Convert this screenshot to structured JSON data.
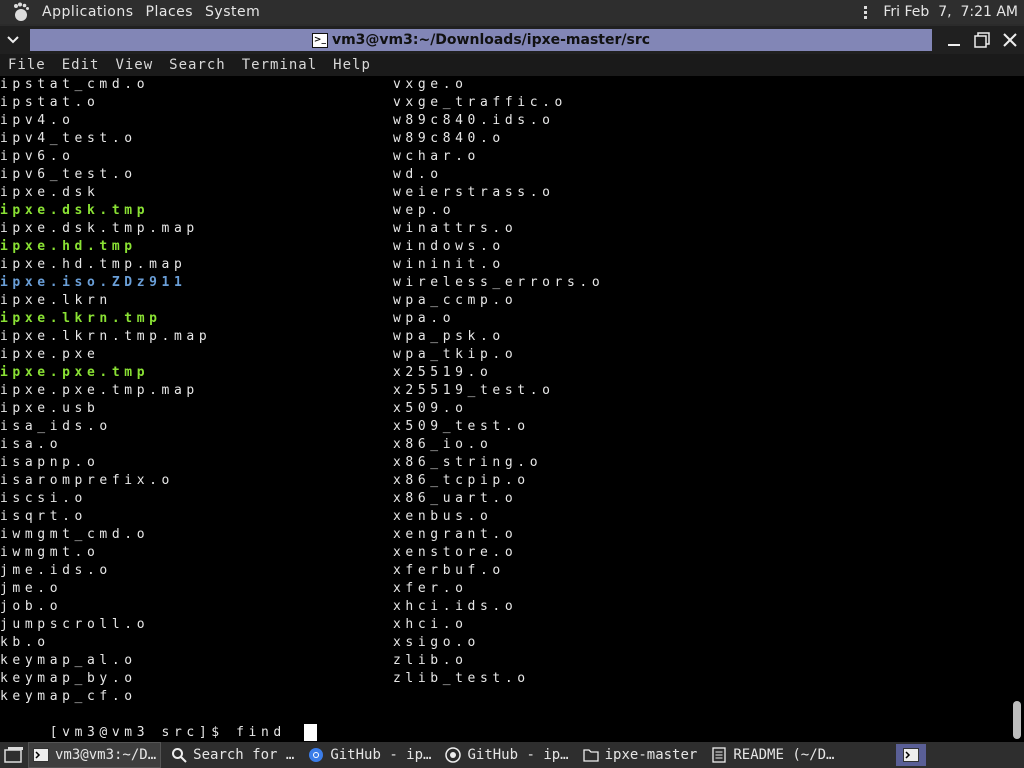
{
  "top_panel": {
    "menus": [
      "Applications",
      "Places",
      "System"
    ],
    "datetime": "Fri Feb  7,  7:21 AM"
  },
  "window": {
    "title": "vm3@vm3:~/Downloads/ipxe-master/src"
  },
  "terminal_menu": [
    "File",
    "Edit",
    "View",
    "Search",
    "Terminal",
    "Help"
  ],
  "terminal": {
    "left_column": [
      {
        "text": "ipstat_cmd.o",
        "style": "normal"
      },
      {
        "text": "ipstat.o",
        "style": "normal"
      },
      {
        "text": "ipv4.o",
        "style": "normal"
      },
      {
        "text": "ipv4_test.o",
        "style": "normal"
      },
      {
        "text": "ipv6.o",
        "style": "normal"
      },
      {
        "text": "ipv6_test.o",
        "style": "normal"
      },
      {
        "text": "ipxe.dsk",
        "style": "normal"
      },
      {
        "text": "ipxe.dsk.tmp",
        "style": "green"
      },
      {
        "text": "ipxe.dsk.tmp.map",
        "style": "normal"
      },
      {
        "text": "ipxe.hd.tmp",
        "style": "green"
      },
      {
        "text": "ipxe.hd.tmp.map",
        "style": "normal"
      },
      {
        "text": "ipxe.iso.ZDz911",
        "style": "blue"
      },
      {
        "text": "ipxe.lkrn",
        "style": "normal"
      },
      {
        "text": "ipxe.lkrn.tmp",
        "style": "green"
      },
      {
        "text": "ipxe.lkrn.tmp.map",
        "style": "normal"
      },
      {
        "text": "ipxe.pxe",
        "style": "normal"
      },
      {
        "text": "ipxe.pxe.tmp",
        "style": "green"
      },
      {
        "text": "ipxe.pxe.tmp.map",
        "style": "normal"
      },
      {
        "text": "ipxe.usb",
        "style": "normal"
      },
      {
        "text": "isa_ids.o",
        "style": "normal"
      },
      {
        "text": "isa.o",
        "style": "normal"
      },
      {
        "text": "isapnp.o",
        "style": "normal"
      },
      {
        "text": "isaromprefix.o",
        "style": "normal"
      },
      {
        "text": "iscsi.o",
        "style": "normal"
      },
      {
        "text": "isqrt.o",
        "style": "normal"
      },
      {
        "text": "iwmgmt_cmd.o",
        "style": "normal"
      },
      {
        "text": "iwmgmt.o",
        "style": "normal"
      },
      {
        "text": "jme.ids.o",
        "style": "normal"
      },
      {
        "text": "jme.o",
        "style": "normal"
      },
      {
        "text": "job.o",
        "style": "normal"
      },
      {
        "text": "jumpscroll.o",
        "style": "normal"
      },
      {
        "text": "kb.o",
        "style": "normal"
      },
      {
        "text": "keymap_al.o",
        "style": "normal"
      },
      {
        "text": "keymap_by.o",
        "style": "normal"
      },
      {
        "text": "keymap_cf.o",
        "style": "normal"
      }
    ],
    "right_column": [
      {
        "text": "vxge.o",
        "style": "normal"
      },
      {
        "text": "vxge_traffic.o",
        "style": "normal"
      },
      {
        "text": "w89c840.ids.o",
        "style": "normal"
      },
      {
        "text": "w89c840.o",
        "style": "normal"
      },
      {
        "text": "wchar.o",
        "style": "normal"
      },
      {
        "text": "wd.o",
        "style": "normal"
      },
      {
        "text": "weierstrass.o",
        "style": "normal"
      },
      {
        "text": "wep.o",
        "style": "normal"
      },
      {
        "text": "winattrs.o",
        "style": "normal"
      },
      {
        "text": "windows.o",
        "style": "normal"
      },
      {
        "text": "wininit.o",
        "style": "normal"
      },
      {
        "text": "wireless_errors.o",
        "style": "normal"
      },
      {
        "text": "wpa_ccmp.o",
        "style": "normal"
      },
      {
        "text": "wpa.o",
        "style": "normal"
      },
      {
        "text": "wpa_psk.o",
        "style": "normal"
      },
      {
        "text": "wpa_tkip.o",
        "style": "normal"
      },
      {
        "text": "x25519.o",
        "style": "normal"
      },
      {
        "text": "x25519_test.o",
        "style": "normal"
      },
      {
        "text": "x509.o",
        "style": "normal"
      },
      {
        "text": "x509_test.o",
        "style": "normal"
      },
      {
        "text": "x86_io.o",
        "style": "normal"
      },
      {
        "text": "x86_string.o",
        "style": "normal"
      },
      {
        "text": "x86_tcpip.o",
        "style": "normal"
      },
      {
        "text": "x86_uart.o",
        "style": "normal"
      },
      {
        "text": "xenbus.o",
        "style": "normal"
      },
      {
        "text": "xengrant.o",
        "style": "normal"
      },
      {
        "text": "xenstore.o",
        "style": "normal"
      },
      {
        "text": "xferbuf.o",
        "style": "normal"
      },
      {
        "text": "xfer.o",
        "style": "normal"
      },
      {
        "text": "xhci.ids.o",
        "style": "normal"
      },
      {
        "text": "xhci.o",
        "style": "normal"
      },
      {
        "text": "xsigo.o",
        "style": "normal"
      },
      {
        "text": "zlib.o",
        "style": "normal"
      },
      {
        "text": "zlib_test.o",
        "style": "normal"
      }
    ],
    "prompt": "[vm3@vm3 src]$ find "
  },
  "colors": {
    "executable_green": "#8ae234",
    "directory_blue": "#6a9fd8",
    "title_bar": "#8286b6"
  },
  "taskbar": {
    "tasks": [
      {
        "label": "vm3@vm3:~/D…",
        "icon": "terminal-icon"
      },
      {
        "label": "Search for …",
        "icon": "search-icon"
      },
      {
        "label": "GitHub - ip…",
        "icon": "chrome-icon"
      },
      {
        "label": "GitHub - ip…",
        "icon": "github-icon"
      },
      {
        "label": "ipxe-master",
        "icon": "folder-icon"
      },
      {
        "label": "README (~/D…",
        "icon": "text-editor-icon"
      }
    ]
  }
}
